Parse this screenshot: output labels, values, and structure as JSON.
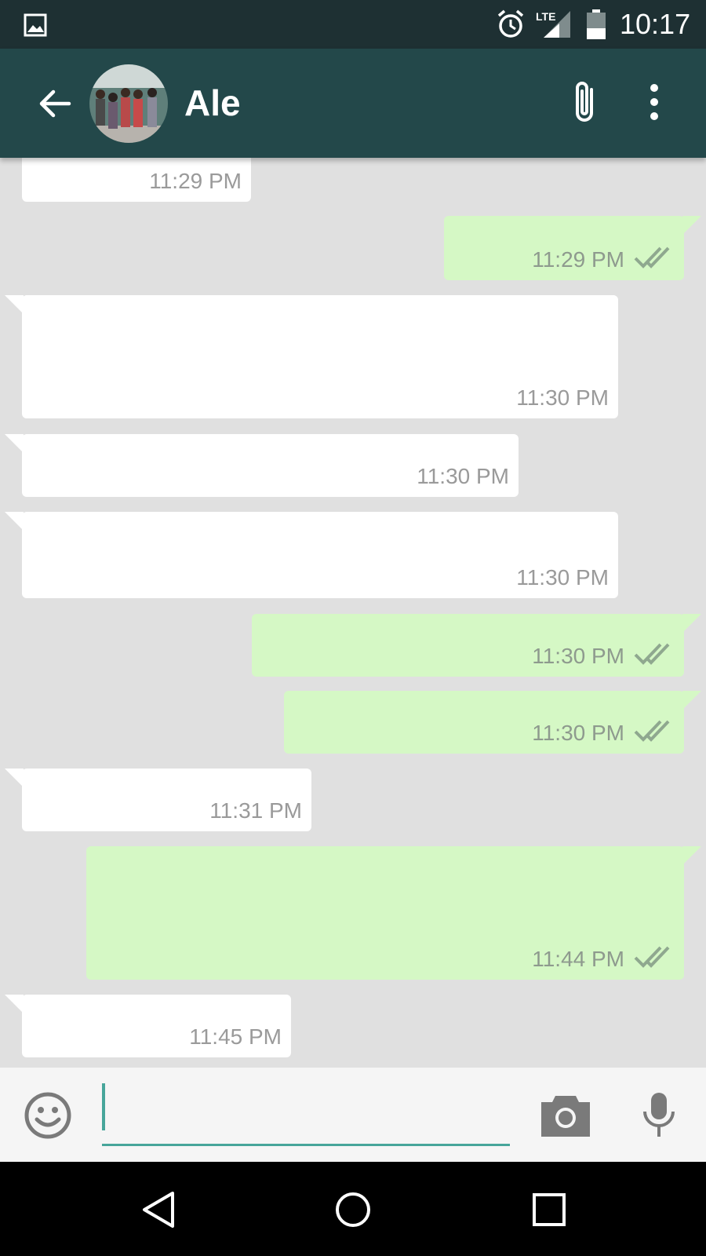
{
  "status_bar": {
    "time": "10:17",
    "network": "LTE",
    "icons": [
      "image-notification-icon",
      "alarm-icon",
      "lte-signal-icon",
      "battery-icon"
    ]
  },
  "header": {
    "contact_name": "Ale",
    "icons": [
      "back-arrow-icon",
      "contact-avatar",
      "paperclip-icon",
      "more-vert-icon"
    ]
  },
  "messages": [
    {
      "direction": "in",
      "time": "11:29 PM"
    },
    {
      "direction": "out",
      "time": "11:29 PM",
      "status": "read"
    },
    {
      "direction": "in",
      "time": "11:30 PM"
    },
    {
      "direction": "in",
      "time": "11:30 PM"
    },
    {
      "direction": "in",
      "time": "11:30 PM"
    },
    {
      "direction": "out",
      "time": "11:30 PM",
      "status": "read"
    },
    {
      "direction": "out",
      "time": "11:30 PM",
      "status": "read"
    },
    {
      "direction": "in",
      "time": "11:31 PM"
    },
    {
      "direction": "out",
      "time": "11:44 PM",
      "status": "read"
    },
    {
      "direction": "in",
      "time": "11:45 PM"
    }
  ],
  "composer": {
    "value": "",
    "placeholder": "",
    "icons": [
      "emoji-icon",
      "camera-icon",
      "mic-icon"
    ]
  },
  "colors": {
    "status_bar": "#1e3033",
    "app_bar": "#23484a",
    "chat_bg": "#e0e0e0",
    "incoming_bubble": "#ffffff",
    "outgoing_bubble": "#d5f8c5",
    "accent": "#47a59a",
    "timestamp": "#9a9a9a"
  },
  "nav_bar": {
    "icons": [
      "back-triangle-icon",
      "home-circle-icon",
      "recents-square-icon"
    ]
  }
}
